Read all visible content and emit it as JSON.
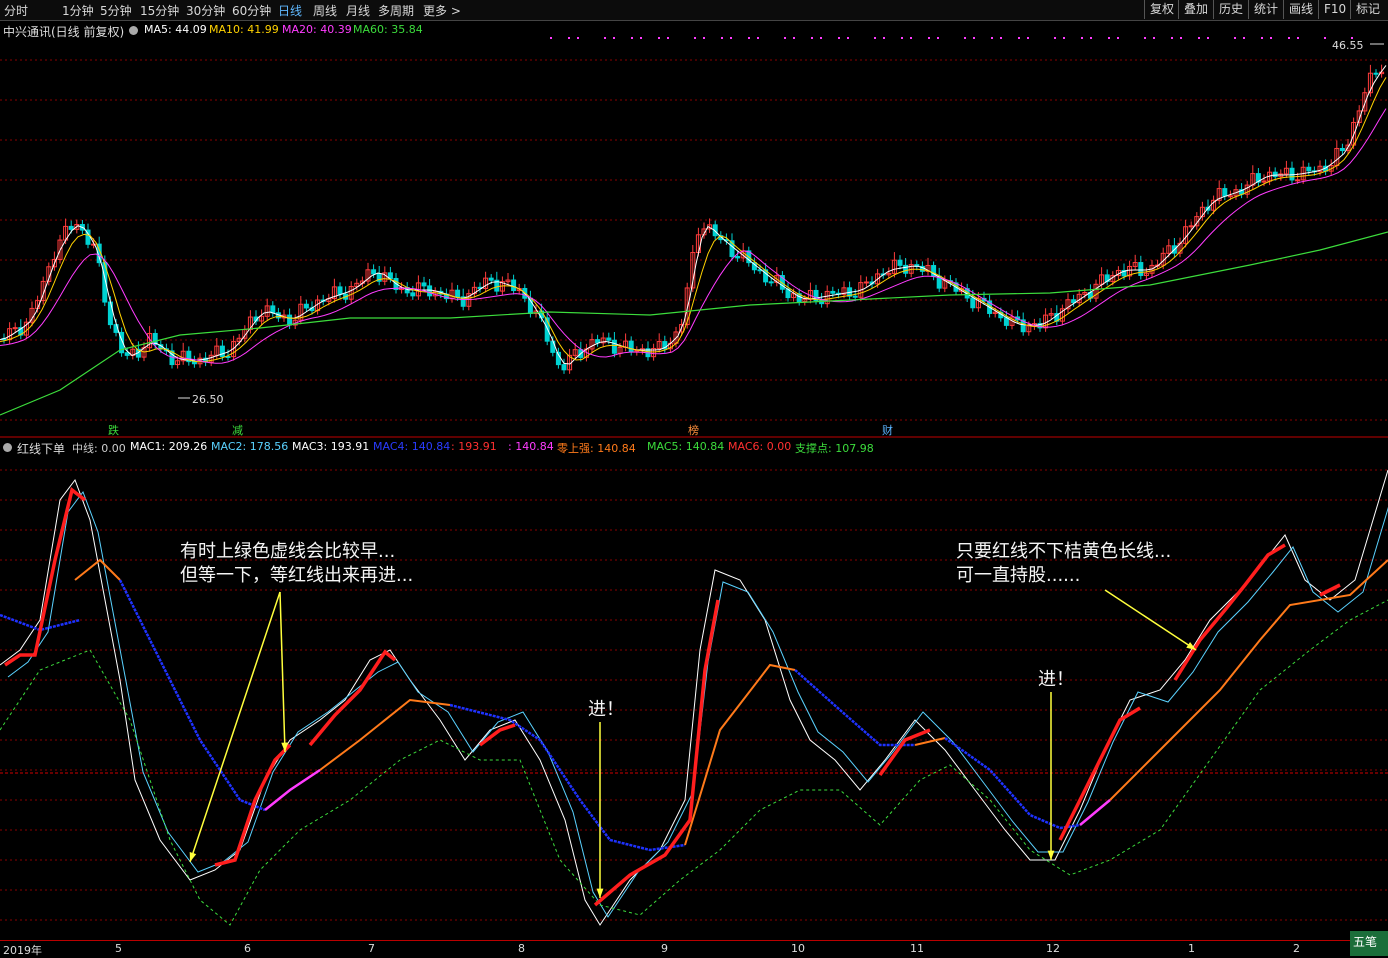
{
  "toolbar": {
    "timeframes": [
      "分时",
      "1分钟",
      "5分钟",
      "15分钟",
      "30分钟",
      "60分钟",
      "日线",
      "周线",
      "月线",
      "多周期",
      "更多 >"
    ],
    "active_timeframe": "日线",
    "right_buttons": [
      "复权",
      "叠加",
      "历史",
      "统计",
      "画线",
      "F10",
      "标记"
    ]
  },
  "stock": {
    "name": "中兴通讯(日线 前复权)",
    "ma_labels": [
      {
        "text": "MA5: 44.09",
        "color": "#ffffff"
      },
      {
        "text": "MA10: 41.99",
        "color": "#ffd200"
      },
      {
        "text": "MA20: 40.39",
        "color": "#ff3cff"
      },
      {
        "text": "MA60: 35.84",
        "color": "#3cdc3c"
      }
    ]
  },
  "indicator": {
    "name": "红线下单",
    "labels": [
      {
        "text": "中线: 0.00",
        "color": "#cccccc"
      },
      {
        "text": "MAC1: 209.26",
        "color": "#ffffff"
      },
      {
        "text": "MAC2: 178.56",
        "color": "#5ad2ff"
      },
      {
        "text": "MAC3: 193.91",
        "color": "#ffffff"
      },
      {
        "text": "MAC4: 140.84",
        "color": "#2a3cff"
      },
      {
        "text": ": 193.91",
        "color": "#ff3030"
      },
      {
        "text": ": 140.84",
        "color": "#ff3cff"
      },
      {
        "text": "零上强: 140.84",
        "color": "#ff7a1a"
      },
      {
        "text": "MAC5: 140.84",
        "color": "#3cdc3c"
      },
      {
        "text": "MAC6: 0.00",
        "color": "#ff3030"
      },
      {
        "text": "支撑点: 107.98",
        "color": "#3cdc3c"
      }
    ]
  },
  "price_marks": {
    "high": "46.55",
    "low": "26.50"
  },
  "event_labels": [
    {
      "text": "跌",
      "color": "#3cdc3c"
    },
    {
      "text": "减",
      "color": "#3cdc3c"
    },
    {
      "text": "榜",
      "color": "#ff8f3c"
    },
    {
      "text": "财",
      "color": "#5ab4ff"
    }
  ],
  "annotations": {
    "note_left": [
      "有时上绿色虚线会比较早...",
      "但等一下，等红线出来再进..."
    ],
    "note_right": [
      "只要红线不下桔黄色长线...",
      "可一直持股......"
    ],
    "jin_1": "进！",
    "jin_2": "进！"
  },
  "x_axis": [
    "2019年",
    "5",
    "6",
    "7",
    "8",
    "9",
    "10",
    "11",
    "12",
    "1",
    "2"
  ],
  "bottom_button": "五笔",
  "colors": {
    "up": "#ff3c3c",
    "down": "#00d2d2",
    "ma5": "#ffffff",
    "ma10": "#ffd200",
    "ma20": "#ff3cff",
    "ma60": "#3cdc3c",
    "grid": "#8a0000",
    "blue": "#1e32ff",
    "orange": "#ff7a1a",
    "magenta": "#ff3cff",
    "cyan": "#5ad2ff",
    "green_dot": "#3cdc3c",
    "red": "#ff1e1e",
    "yellow": "#ffff3c"
  }
}
